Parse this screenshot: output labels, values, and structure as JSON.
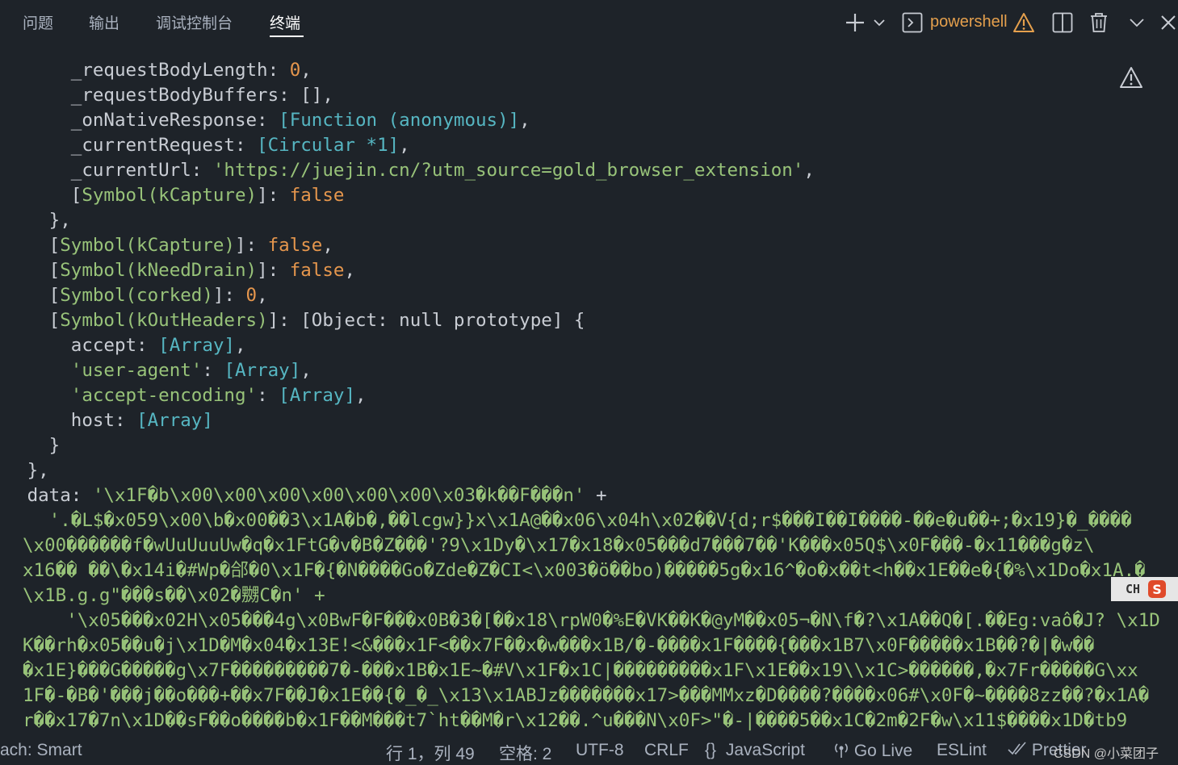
{
  "panel_tabs": [
    {
      "label": "问题",
      "active": false
    },
    {
      "label": "输出",
      "active": false
    },
    {
      "label": "调试控制台",
      "active": false
    },
    {
      "label": "终端",
      "active": true
    }
  ],
  "toolbar": {
    "shell_name": "powershell",
    "icons": [
      "plus-icon",
      "chevron-down-icon",
      "terminal-icon",
      "warning-icon",
      "split-icon",
      "trash-icon",
      "chevron-down-icon",
      "close-icon"
    ]
  },
  "terminal_lines": [
    [
      {
        "t": "      _requestBodyLength: ",
        "c": "w"
      },
      {
        "t": "0",
        "c": "o"
      },
      {
        "t": ",",
        "c": "w"
      }
    ],
    [
      {
        "t": "      _requestBodyBuffers: [],",
        "c": "w"
      }
    ],
    [
      {
        "t": "      _onNativeResponse: ",
        "c": "w"
      },
      {
        "t": "[Function (anonymous)]",
        "c": "c"
      },
      {
        "t": ",",
        "c": "w"
      }
    ],
    [
      {
        "t": "      _currentRequest: ",
        "c": "w"
      },
      {
        "t": "[Circular *1]",
        "c": "c"
      },
      {
        "t": ",",
        "c": "w"
      }
    ],
    [
      {
        "t": "      _currentUrl: ",
        "c": "w"
      },
      {
        "t": "'https://juejin.cn/?utm_source=gold_browser_extension'",
        "c": "g"
      },
      {
        "t": ",",
        "c": "w"
      }
    ],
    [
      {
        "t": "      [",
        "c": "w"
      },
      {
        "t": "Symbol(kCapture)",
        "c": "g"
      },
      {
        "t": "]: ",
        "c": "w"
      },
      {
        "t": "false",
        "c": "o"
      }
    ],
    [
      {
        "t": "    },",
        "c": "w"
      }
    ],
    [
      {
        "t": "    [",
        "c": "w"
      },
      {
        "t": "Symbol(kCapture)",
        "c": "g"
      },
      {
        "t": "]: ",
        "c": "w"
      },
      {
        "t": "false",
        "c": "o"
      },
      {
        "t": ",",
        "c": "w"
      }
    ],
    [
      {
        "t": "    [",
        "c": "w"
      },
      {
        "t": "Symbol(kNeedDrain)",
        "c": "g"
      },
      {
        "t": "]: ",
        "c": "w"
      },
      {
        "t": "false",
        "c": "o"
      },
      {
        "t": ",",
        "c": "w"
      }
    ],
    [
      {
        "t": "    [",
        "c": "w"
      },
      {
        "t": "Symbol(corked)",
        "c": "g"
      },
      {
        "t": "]: ",
        "c": "w"
      },
      {
        "t": "0",
        "c": "o"
      },
      {
        "t": ",",
        "c": "w"
      }
    ],
    [
      {
        "t": "    [",
        "c": "w"
      },
      {
        "t": "Symbol(kOutHeaders)",
        "c": "g"
      },
      {
        "t": "]: [Object: null prototype] {",
        "c": "w"
      }
    ],
    [
      {
        "t": "      accept: ",
        "c": "w"
      },
      {
        "t": "[Array]",
        "c": "c"
      },
      {
        "t": ",",
        "c": "w"
      }
    ],
    [
      {
        "t": "      ",
        "c": "w"
      },
      {
        "t": "'user-agent'",
        "c": "g"
      },
      {
        "t": ": ",
        "c": "w"
      },
      {
        "t": "[Array]",
        "c": "c"
      },
      {
        "t": ",",
        "c": "w"
      }
    ],
    [
      {
        "t": "      ",
        "c": "w"
      },
      {
        "t": "'accept-encoding'",
        "c": "g"
      },
      {
        "t": ": ",
        "c": "w"
      },
      {
        "t": "[Array]",
        "c": "c"
      },
      {
        "t": ",",
        "c": "w"
      }
    ],
    [
      {
        "t": "      host: ",
        "c": "w"
      },
      {
        "t": "[Array]",
        "c": "c"
      }
    ],
    [
      {
        "t": "    }",
        "c": "w"
      }
    ],
    [
      {
        "t": "  },",
        "c": "w"
      }
    ],
    [
      {
        "t": "  data: ",
        "c": "w"
      },
      {
        "t": "'\\x1F�b\\x00\\x00\\x00\\x00\\x00\\x00\\x03�k��F���n'",
        "c": "g"
      },
      {
        "t": " +",
        "c": "w"
      }
    ],
    [
      {
        "t": "    ",
        "c": "w"
      },
      {
        "t": "'.�L$�x059\\x00\\b�x00��3\\x1A�b�,��lcgw}}x\\x1A@��x06\\x04h\\x02��V{d;r$���I��I����-��e�u��+;�x19}�_����",
        "c": "g"
      }
    ]
  ],
  "wrapped_lines": [
    "\\x00������f�wUuUuuUw�q�x1FtG�v�B�Z���'?9\\x1Dy�\\x17�x18�x05���d7���7��'K���x05Q$\\x0F���-�x11���g�z\\",
    "x16�� ��\\�x14i�#Wp�郃�0\\x1F�{�N����Go�Zde�Z�CI<\\x003�ö��bo)�����5g�x16^�o�x��t<h��x1E��e�{�%\\x1Do�x1A.�",
    "\\x1B.g.g\"���s��\\x02�嬲C�n' +",
    "    '\\x05���x02H\\x05���4g\\x0BwF�F���x0B�3�[��x18\\rpW0�%E�VK��K�@yM��x05¬�N\\f�?\\x1A��Q�[.��Eg:vaô�J? \\x1D",
    "K��rh�x05��u�j\\x1D�M�x04�x13E!<&���x1F<��x7F��x�w���x1B/�-����x1F����{���x1B7\\x0F�����x1B��?�|�w��",
    "�x1E}���G�����g\\x7F���������7�-���x1B�x1E~�#V\\x1F�x1C|���������x1F\\x1E��x19\\\\x1C>������,�x7Fr�����G\\xx",
    "1F�-�B�'���j��o���+��x7F��J�x1E��{�_�_\\x13\\x1ABJz�������x17>���MMxz�D����?����x06#\\x0F�~����8zz��?�x1A�",
    "r��x17�7n\\x1D��sF��o����b�x1F��M���t7`ht��M�r\\x12��.^u���N\\x0F>\"�-|����5��x1C�2m�2F�w\\x11$����x1D�tb9"
  ],
  "ime": {
    "label": "CH",
    "logo": "S"
  },
  "statusbar": {
    "branch_partial": "ach: Smart",
    "cursor": "行 1，列 49",
    "indent": "空格: 2",
    "encoding": "UTF-8",
    "eol": "CRLF",
    "language_symbol": "{}",
    "language": "JavaScript",
    "golive": "Go Live",
    "eslint": "ESLint",
    "prettier": "Prettier",
    "watermark": "CSDN @小菜团子"
  }
}
